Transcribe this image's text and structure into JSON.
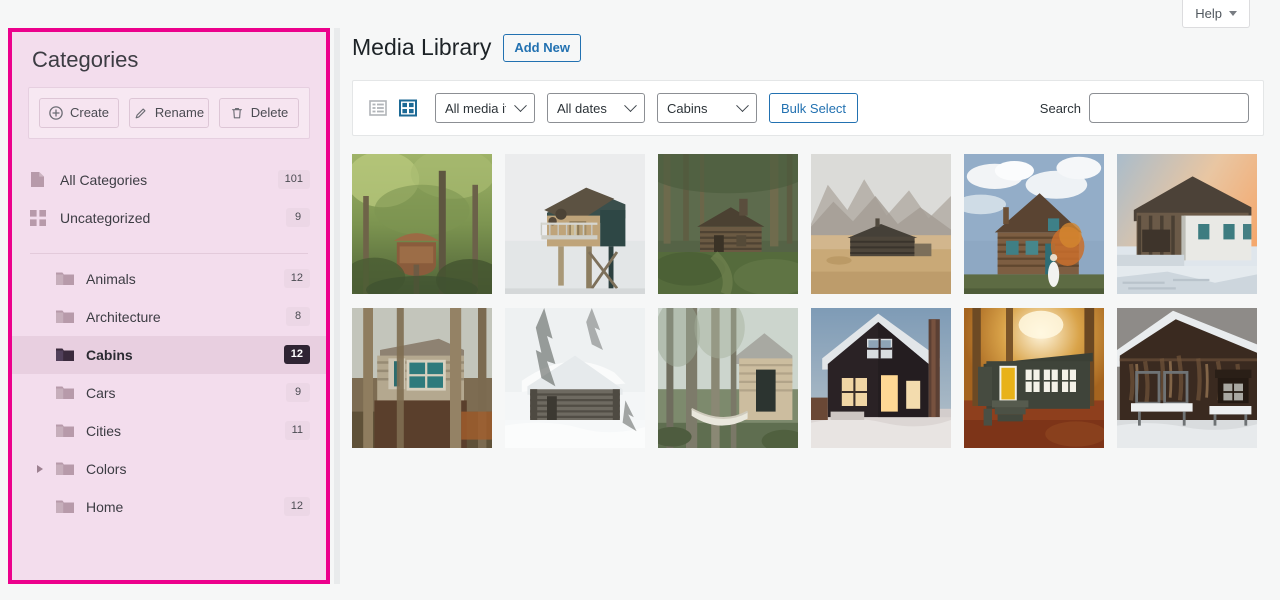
{
  "topbar": {
    "help_label": "Help",
    "help_icon": "chevron-down-icon"
  },
  "sidebar": {
    "title": "Categories",
    "actions": [
      {
        "label": "Create",
        "icon": "plus-circle-icon"
      },
      {
        "label": "Rename",
        "icon": "pencil-icon"
      },
      {
        "label": "Delete",
        "icon": "trash-icon"
      }
    ],
    "top_items": [
      {
        "label": "All Categories",
        "count": "101",
        "icon": "page-icon",
        "selected": false
      },
      {
        "label": "Uncategorized",
        "count": "9",
        "icon": "grid-squares-icon",
        "selected": false
      }
    ],
    "categories": [
      {
        "label": "Animals",
        "count": "12",
        "icon": "folder-icon",
        "selected": false,
        "expandable": false
      },
      {
        "label": "Architecture",
        "count": "8",
        "icon": "folder-icon",
        "selected": false,
        "expandable": false
      },
      {
        "label": "Cabins",
        "count": "12",
        "icon": "folder-icon",
        "selected": true,
        "expandable": false
      },
      {
        "label": "Cars",
        "count": "9",
        "icon": "folder-icon",
        "selected": false,
        "expandable": false
      },
      {
        "label": "Cities",
        "count": "11",
        "icon": "folder-icon",
        "selected": false,
        "expandable": false
      },
      {
        "label": "Colors",
        "count": "",
        "icon": "folder-icon",
        "selected": false,
        "expandable": true
      },
      {
        "label": "Home",
        "count": "12",
        "icon": "folder-icon",
        "selected": false,
        "expandable": false
      }
    ],
    "border_color": "#ec008c",
    "background_color": "#f3dded"
  },
  "main": {
    "page_title": "Media Library",
    "add_new_label": "Add New",
    "toolbar": {
      "list_view_icon": "list-view-icon",
      "grid_view_icon": "grid-view-icon",
      "active_view": "grid",
      "media_type_value": "All media it",
      "dates_value": "All dates",
      "category_value": "Cabins",
      "bulk_select_label": "Bulk Select",
      "search_label": "Search",
      "search_value": "",
      "search_placeholder": ""
    },
    "grid_items": [
      {
        "alt": "treehouse platform in leafy green forest canopy"
      },
      {
        "alt": "modern stilt cabin with deck against pale sky"
      },
      {
        "alt": "log cabin in dense pine forest clearing"
      },
      {
        "alt": "dark wooden hut on dry plain below misty mountains"
      },
      {
        "alt": "weathered wood cabin with cloudy sky and person in white dress"
      },
      {
        "alt": "white clapboard cabin in snow at orange sunset"
      },
      {
        "alt": "treehouse cabin with teal window among pine trunks"
      },
      {
        "alt": "snow covered log cabin in winter whiteout"
      },
      {
        "alt": "small cabin with hammock in misty evergreen forest"
      },
      {
        "alt": "dark cabin lit from within on snowy blue evening"
      },
      {
        "alt": "dark tiny house with yellow door in autumn leaves"
      },
      {
        "alt": "dark barn with snow covered benches in winter"
      }
    ]
  },
  "theme": {
    "accent_blue": "#2271b1",
    "page_background": "#f6f7f7",
    "selected_badge_bg": "#2f2433"
  }
}
